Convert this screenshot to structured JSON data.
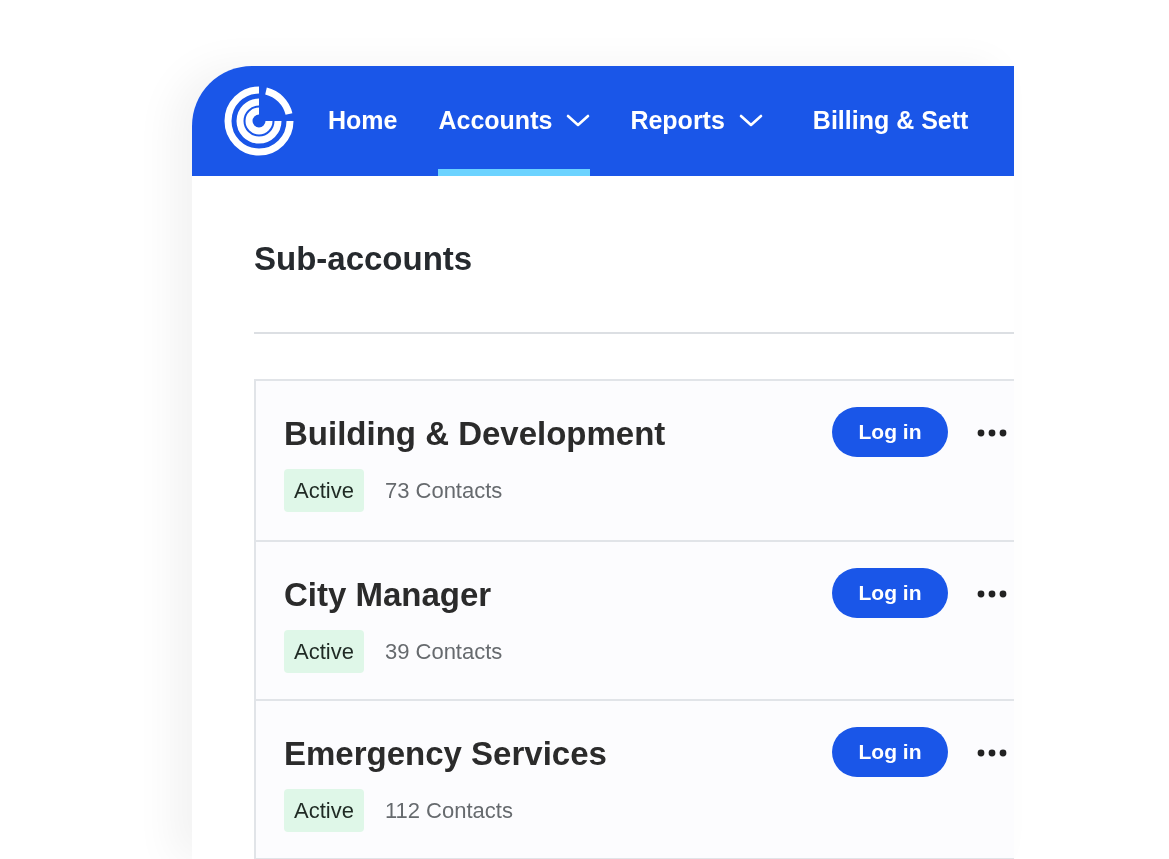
{
  "nav": {
    "items": [
      {
        "label": "Home",
        "dropdown": false,
        "selected": false
      },
      {
        "label": "Accounts",
        "dropdown": true,
        "selected": true
      },
      {
        "label": "Reports",
        "dropdown": true,
        "selected": false
      },
      {
        "label": "Billing & Sett",
        "dropdown": false,
        "selected": false
      }
    ]
  },
  "page": {
    "title": "Sub-accounts"
  },
  "accounts": [
    {
      "name": "Building & Development",
      "status": "Active",
      "contacts": "73 Contacts",
      "action": "Log in"
    },
    {
      "name": "City Manager",
      "status": "Active",
      "contacts": "39 Contacts",
      "action": "Log in"
    },
    {
      "name": "Emergency Services",
      "status": "Active",
      "contacts": "112 Contacts",
      "action": "Log in"
    }
  ]
}
